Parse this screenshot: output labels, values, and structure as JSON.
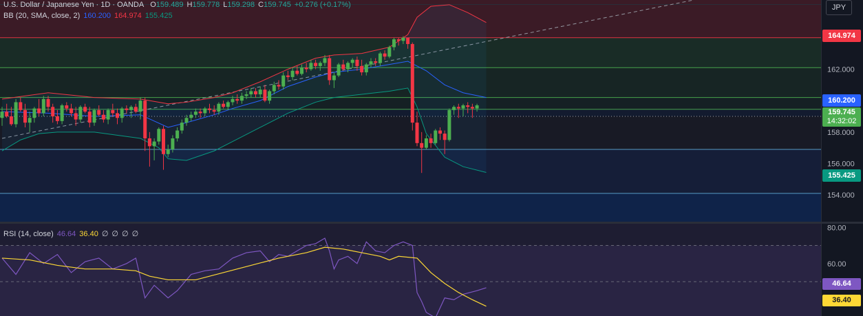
{
  "header": {
    "title": "U.S. Dollar / Japanese Yen · 1D · OANDA",
    "o_label": "O",
    "o": "159.489",
    "h_label": "H",
    "h": "159.778",
    "l_label": "L",
    "l": "159.298",
    "c_label": "C",
    "c": "159.745",
    "change": "+0.276 (+0.17%)"
  },
  "bb_legend": {
    "label": "BB (20, SMA, close, 2)",
    "basis": "160.200",
    "upper": "164.974",
    "lower": "155.425"
  },
  "rsi_legend": {
    "label": "RSI (14, close)",
    "rsi": "46.64",
    "ma": "36.40",
    "extras": [
      "∅",
      "∅",
      "∅",
      "∅"
    ]
  },
  "axis_unit": "JPY",
  "tags": {
    "upper": "164.974",
    "basis": "160.200",
    "price": "159.745",
    "countdown": "14:32:02",
    "lower": "155.425",
    "rsi": "46.64",
    "rsi_ma": "36.40"
  },
  "colors": {
    "background": "#131722",
    "up": "#26a69a",
    "down": "#ef5350",
    "candle_up": "#4caf50",
    "candle_down": "#f23645",
    "bb_basis": "#2962ff",
    "bb_upper": "#f23645",
    "bb_lower": "#089981",
    "rsi": "#7e57c2",
    "rsi_ma": "#fdd835",
    "price_tag": "#4caf50"
  },
  "chart_data": [
    {
      "type": "candlestick",
      "title": "U.S. Dollar / Japanese Yen · 1D · OANDA",
      "ylim": [
        152.3,
        166.4
      ],
      "yticks": [
        "154.000",
        "156.000",
        "158.000",
        "160.000",
        "162.000",
        "164.000"
      ],
      "ytick_values": [
        154,
        156,
        158,
        160,
        162,
        164
      ],
      "horizontal_levels": [
        164.0,
        162.1,
        160.2,
        159.45,
        159.0,
        156.9,
        154.1
      ],
      "trendline": {
        "from": [
          0,
          157.6
        ],
        "to": [
          150,
          166.4
        ],
        "style": "dashed"
      },
      "bands_period_end_index": 105,
      "ohlc": [
        [
          158.9,
          159.6,
          158.4,
          159.3
        ],
        [
          159.3,
          159.8,
          158.9,
          159.0
        ],
        [
          159.0,
          159.6,
          158.4,
          158.5
        ],
        [
          158.5,
          160.1,
          158.3,
          159.9
        ],
        [
          159.9,
          160.2,
          159.3,
          159.4
        ],
        [
          159.4,
          159.8,
          158.3,
          158.6
        ],
        [
          158.6,
          159.3,
          158.0,
          158.9
        ],
        [
          158.9,
          159.6,
          158.6,
          159.5
        ],
        [
          159.5,
          160.1,
          159.0,
          159.2
        ],
        [
          159.2,
          160.3,
          159.0,
          160.1
        ],
        [
          160.1,
          160.3,
          159.3,
          159.6
        ],
        [
          159.6,
          159.8,
          158.6,
          159.0
        ],
        [
          159.0,
          159.4,
          158.5,
          158.7
        ],
        [
          158.7,
          159.8,
          158.5,
          159.7
        ],
        [
          159.7,
          159.9,
          159.3,
          159.5
        ],
        [
          159.5,
          159.8,
          159.0,
          159.2
        ],
        [
          159.2,
          159.6,
          158.4,
          158.8
        ],
        [
          158.8,
          159.7,
          158.6,
          159.6
        ],
        [
          159.6,
          159.8,
          159.2,
          159.3
        ],
        [
          159.3,
          159.6,
          158.3,
          158.6
        ],
        [
          158.6,
          159.5,
          158.4,
          159.4
        ],
        [
          159.4,
          159.7,
          159.0,
          159.1
        ],
        [
          159.1,
          159.4,
          158.6,
          158.8
        ],
        [
          158.8,
          159.5,
          158.5,
          159.4
        ],
        [
          159.4,
          159.8,
          159.0,
          159.2
        ],
        [
          159.2,
          159.5,
          158.5,
          158.9
        ],
        [
          158.9,
          159.6,
          158.6,
          159.5
        ],
        [
          159.5,
          159.7,
          159.2,
          159.4
        ],
        [
          159.4,
          159.7,
          158.9,
          159.6
        ],
        [
          159.6,
          159.8,
          159.2,
          159.3
        ],
        [
          159.3,
          160.2,
          158.8,
          160.0
        ],
        [
          160.0,
          160.2,
          156.8,
          157.6
        ],
        [
          157.6,
          158.0,
          155.8,
          157.1
        ],
        [
          157.1,
          157.6,
          156.2,
          157.4
        ],
        [
          157.4,
          158.3,
          157.2,
          158.2
        ],
        [
          158.2,
          158.4,
          155.6,
          156.6
        ],
        [
          156.6,
          157.2,
          156.4,
          156.9
        ],
        [
          156.9,
          157.8,
          156.7,
          157.6
        ],
        [
          157.6,
          158.3,
          157.4,
          158.1
        ],
        [
          158.1,
          158.8,
          157.9,
          158.6
        ],
        [
          158.6,
          159.1,
          158.4,
          158.9
        ],
        [
          158.9,
          159.3,
          158.7,
          159.1
        ],
        [
          159.1,
          159.5,
          158.9,
          159.3
        ],
        [
          159.3,
          159.5,
          158.9,
          159.2
        ],
        [
          159.2,
          159.6,
          159.0,
          159.5
        ],
        [
          159.5,
          159.8,
          159.2,
          159.4
        ],
        [
          159.4,
          159.7,
          159.1,
          159.3
        ],
        [
          159.3,
          159.9,
          159.1,
          159.8
        ],
        [
          159.8,
          160.0,
          159.5,
          159.6
        ],
        [
          159.6,
          160.0,
          159.4,
          159.9
        ],
        [
          159.9,
          160.3,
          159.7,
          160.1
        ],
        [
          160.1,
          160.4,
          159.8,
          160.0
        ],
        [
          160.0,
          160.5,
          159.8,
          160.3
        ],
        [
          160.3,
          160.6,
          160.1,
          160.4
        ],
        [
          160.4,
          160.8,
          160.2,
          160.6
        ],
        [
          160.6,
          160.8,
          160.2,
          160.4
        ],
        [
          160.4,
          160.9,
          160.2,
          160.7
        ],
        [
          160.7,
          161.0,
          159.9,
          160.0
        ],
        [
          160.0,
          160.7,
          159.8,
          160.6
        ],
        [
          160.6,
          161.2,
          160.4,
          161.0
        ],
        [
          161.0,
          161.3,
          160.7,
          160.9
        ],
        [
          160.9,
          161.8,
          160.7,
          161.6
        ],
        [
          161.6,
          161.9,
          161.3,
          161.5
        ],
        [
          161.5,
          162.1,
          161.3,
          161.9
        ],
        [
          161.9,
          162.2,
          161.6,
          161.7
        ],
        [
          161.7,
          162.3,
          161.6,
          162.1
        ],
        [
          162.1,
          162.4,
          161.8,
          162.0
        ],
        [
          162.0,
          162.6,
          161.9,
          162.4
        ],
        [
          162.4,
          162.6,
          162.0,
          162.2
        ],
        [
          162.2,
          162.5,
          161.9,
          162.4
        ],
        [
          162.4,
          162.9,
          162.2,
          162.7
        ],
        [
          162.7,
          162.9,
          161.0,
          161.3
        ],
        [
          161.3,
          161.8,
          160.8,
          161.6
        ],
        [
          161.6,
          162.4,
          161.5,
          162.3
        ],
        [
          162.3,
          162.6,
          161.9,
          162.0
        ],
        [
          162.0,
          162.5,
          161.8,
          162.4
        ],
        [
          162.4,
          162.7,
          162.1,
          162.6
        ],
        [
          162.6,
          162.8,
          161.9,
          162.2
        ],
        [
          162.2,
          162.6,
          161.6,
          161.8
        ],
        [
          161.8,
          162.4,
          161.6,
          162.3
        ],
        [
          162.3,
          162.7,
          162.1,
          162.5
        ],
        [
          162.5,
          162.7,
          162.2,
          162.4
        ],
        [
          162.4,
          163.1,
          162.2,
          163.0
        ],
        [
          163.0,
          163.2,
          162.6,
          162.8
        ],
        [
          162.8,
          163.5,
          162.7,
          163.4
        ],
        [
          163.4,
          164.0,
          163.2,
          163.9
        ],
        [
          163.9,
          164.0,
          163.5,
          163.8
        ],
        [
          163.8,
          164.1,
          163.6,
          164.0
        ],
        [
          164.0,
          164.0,
          163.3,
          163.6
        ],
        [
          163.6,
          163.7,
          158.1,
          158.6
        ],
        [
          158.6,
          159.3,
          157.1,
          157.3
        ],
        [
          157.3,
          158.0,
          155.4,
          157.0
        ],
        [
          157.0,
          157.8,
          156.9,
          157.6
        ],
        [
          157.6,
          157.9,
          157.0,
          157.3
        ],
        [
          157.3,
          158.2,
          157.2,
          158.1
        ],
        [
          158.1,
          158.3,
          157.5,
          157.9
        ],
        [
          157.9,
          158.1,
          156.6,
          157.5
        ],
        [
          157.5,
          159.5,
          157.4,
          159.4
        ],
        [
          159.4,
          159.7,
          159.1,
          159.6
        ],
        [
          159.6,
          159.8,
          158.9,
          159.5
        ],
        [
          159.5,
          159.8,
          159.0,
          159.7
        ],
        [
          159.7,
          159.9,
          159.2,
          159.6
        ],
        [
          159.6,
          159.8,
          158.9,
          159.5
        ],
        [
          159.5,
          159.8,
          159.3,
          159.7
        ]
      ],
      "bb_basis": [
        [
          0,
          159.3
        ],
        [
          10,
          159.2
        ],
        [
          20,
          159.0
        ],
        [
          30,
          159.1
        ],
        [
          36,
          158.3
        ],
        [
          40,
          158.6
        ],
        [
          46,
          159.1
        ],
        [
          50,
          159.5
        ],
        [
          56,
          160.0
        ],
        [
          62,
          160.9
        ],
        [
          68,
          161.5
        ],
        [
          72,
          161.8
        ],
        [
          78,
          162.0
        ],
        [
          84,
          162.3
        ],
        [
          88,
          162.5
        ],
        [
          92,
          161.9
        ],
        [
          96,
          161.0
        ],
        [
          100,
          160.5
        ],
        [
          105,
          160.2
        ]
      ],
      "bb_upper": [
        [
          0,
          160.1
        ],
        [
          10,
          160.5
        ],
        [
          20,
          160.2
        ],
        [
          30,
          160.1
        ],
        [
          36,
          159.8
        ],
        [
          40,
          159.9
        ],
        [
          46,
          160.2
        ],
        [
          50,
          160.5
        ],
        [
          56,
          161.2
        ],
        [
          62,
          162.0
        ],
        [
          68,
          162.7
        ],
        [
          72,
          162.9
        ],
        [
          78,
          163.0
        ],
        [
          84,
          163.4
        ],
        [
          88,
          164.2
        ],
        [
          90,
          165.3
        ],
        [
          93,
          166.0
        ],
        [
          97,
          166.1
        ],
        [
          101,
          165.6
        ],
        [
          105,
          164.97
        ]
      ],
      "bb_lower": [
        [
          0,
          156.8
        ],
        [
          4,
          157.5
        ],
        [
          8,
          157.9
        ],
        [
          12,
          158.0
        ],
        [
          20,
          158.0
        ],
        [
          30,
          157.6
        ],
        [
          34,
          157.0
        ],
        [
          36,
          156.3
        ],
        [
          40,
          156.2
        ],
        [
          46,
          156.8
        ],
        [
          50,
          157.4
        ],
        [
          56,
          158.3
        ],
        [
          62,
          159.2
        ],
        [
          68,
          159.9
        ],
        [
          72,
          160.2
        ],
        [
          78,
          160.4
        ],
        [
          84,
          160.6
        ],
        [
          88,
          160.8
        ],
        [
          90,
          159.6
        ],
        [
          92,
          157.9
        ],
        [
          96,
          156.4
        ],
        [
          100,
          155.8
        ],
        [
          105,
          155.43
        ]
      ]
    },
    {
      "type": "line",
      "title": "RSI (14, close)",
      "ylim": [
        31,
        82
      ],
      "yticks": [
        "80.00",
        "60.00",
        "40.00"
      ],
      "ytick_values": [
        80,
        60,
        40
      ],
      "levels": [
        70,
        50,
        30
      ],
      "series": [
        {
          "name": "RSI",
          "values": [
            [
              0,
              63
            ],
            [
              3,
              54
            ],
            [
              6,
              66
            ],
            [
              9,
              60
            ],
            [
              12,
              65
            ],
            [
              15,
              55
            ],
            [
              18,
              61
            ],
            [
              21,
              63
            ],
            [
              24,
              57
            ],
            [
              27,
              60
            ],
            [
              29,
              63
            ],
            [
              31,
              41
            ],
            [
              33,
              48
            ],
            [
              36,
              41
            ],
            [
              38,
              45
            ],
            [
              41,
              54
            ],
            [
              44,
              56
            ],
            [
              47,
              57
            ],
            [
              50,
              63
            ],
            [
              53,
              66
            ],
            [
              56,
              67
            ],
            [
              58,
              61
            ],
            [
              60,
              65
            ],
            [
              62,
              64
            ],
            [
              64,
              67
            ],
            [
              66,
              70
            ],
            [
              68,
              71
            ],
            [
              70,
              74
            ],
            [
              71,
              67
            ],
            [
              72,
              57
            ],
            [
              73,
              62
            ],
            [
              75,
              64
            ],
            [
              77,
              60
            ],
            [
              79,
              72
            ],
            [
              81,
              67
            ],
            [
              83,
              66
            ],
            [
              85,
              70
            ],
            [
              87,
              72
            ],
            [
              89,
              70
            ],
            [
              90,
              44
            ],
            [
              91,
              39
            ],
            [
              92,
              33
            ],
            [
              94,
              30
            ],
            [
              96,
              41
            ],
            [
              98,
              40
            ],
            [
              100,
              43
            ],
            [
              103,
              45
            ],
            [
              105,
              46.64
            ]
          ]
        },
        {
          "name": "RSI-based MA",
          "values": [
            [
              0,
              63
            ],
            [
              6,
              62
            ],
            [
              12,
              59
            ],
            [
              18,
              57
            ],
            [
              24,
              57
            ],
            [
              29,
              56
            ],
            [
              32,
              53
            ],
            [
              36,
              51
            ],
            [
              42,
              51
            ],
            [
              48,
              55
            ],
            [
              54,
              59
            ],
            [
              60,
              63
            ],
            [
              66,
              66
            ],
            [
              70,
              69
            ],
            [
              74,
              68
            ],
            [
              78,
              66
            ],
            [
              82,
              64
            ],
            [
              84,
              62
            ],
            [
              86,
              64
            ],
            [
              90,
              63
            ],
            [
              93,
              55
            ],
            [
              96,
              49
            ],
            [
              99,
              44
            ],
            [
              102,
              40
            ],
            [
              105,
              36.4
            ]
          ]
        }
      ]
    }
  ]
}
